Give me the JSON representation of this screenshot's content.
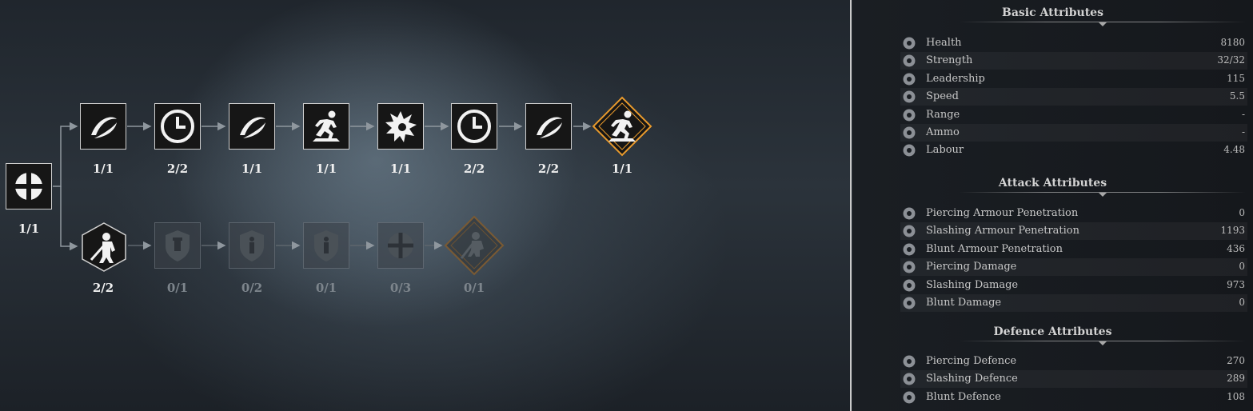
{
  "skill_tree": {
    "root": {
      "icon": "cross-emblem-icon",
      "count": "1/1"
    },
    "top_row": [
      {
        "icon": "slash-arc-icon",
        "count": "1/1",
        "state": "active"
      },
      {
        "icon": "clock-icon",
        "count": "2/2",
        "state": "active"
      },
      {
        "icon": "slash-arc-icon",
        "count": "1/1",
        "state": "active"
      },
      {
        "icon": "sprint-icon",
        "count": "1/1",
        "state": "active"
      },
      {
        "icon": "impact-burst-icon",
        "count": "1/1",
        "state": "active"
      },
      {
        "icon": "clock-icon",
        "count": "2/2",
        "state": "active"
      },
      {
        "icon": "slash-arc-icon",
        "count": "2/2",
        "state": "active"
      },
      {
        "icon": "sprint-icon",
        "count": "1/1",
        "state": "ultimate"
      }
    ],
    "bottom_row": [
      {
        "icon": "knight-sword-icon",
        "count": "2/2",
        "state": "active-hex"
      },
      {
        "icon": "shield-tower-icon",
        "count": "0/1",
        "state": "locked"
      },
      {
        "icon": "shield-figure-icon",
        "count": "0/2",
        "state": "locked"
      },
      {
        "icon": "shield-figure-icon",
        "count": "0/1",
        "state": "locked"
      },
      {
        "icon": "cross-emblem-icon",
        "count": "0/3",
        "state": "locked"
      },
      {
        "icon": "knight-sword-icon",
        "count": "0/1",
        "state": "locked-ultimate"
      }
    ],
    "accent_color": "#e89a2c"
  },
  "attributes": {
    "basic": {
      "title": "Basic Attributes",
      "rows": [
        {
          "icon": "health-cross-icon",
          "label": "Health",
          "value": "8180"
        },
        {
          "icon": "strength-fist-icon",
          "label": "Strength",
          "value": "32/32"
        },
        {
          "icon": "leadership-laurel-icon",
          "label": "Leadership",
          "value": "115"
        },
        {
          "icon": "speed-boot-icon",
          "label": "Speed",
          "value": "5.5"
        },
        {
          "icon": "range-arrows-icon",
          "label": "Range",
          "value": "-"
        },
        {
          "icon": "ammo-bolts-icon",
          "label": "Ammo",
          "value": "-"
        },
        {
          "icon": "labour-hammer-icon",
          "label": "Labour",
          "value": "4.48"
        }
      ]
    },
    "attack": {
      "title": "Attack Attributes",
      "rows": [
        {
          "icon": "piercing-pen-icon",
          "label": "Piercing Armour Penetration",
          "value": "0"
        },
        {
          "icon": "slashing-pen-icon",
          "label": "Slashing Armour Penetration",
          "value": "1193"
        },
        {
          "icon": "blunt-pen-icon",
          "label": "Blunt Armour Penetration",
          "value": "436"
        },
        {
          "icon": "piercing-damage-icon",
          "label": "Piercing Damage",
          "value": "0"
        },
        {
          "icon": "slashing-damage-icon",
          "label": "Slashing Damage",
          "value": "973"
        },
        {
          "icon": "blunt-damage-icon",
          "label": "Blunt Damage",
          "value": "0"
        }
      ]
    },
    "defence": {
      "title": "Defence Attributes",
      "rows": [
        {
          "icon": "piercing-defence-icon",
          "label": "Piercing Defence",
          "value": "270"
        },
        {
          "icon": "slashing-defence-icon",
          "label": "Slashing Defence",
          "value": "289"
        },
        {
          "icon": "blunt-defence-icon",
          "label": "Blunt Defence",
          "value": "108"
        }
      ]
    }
  }
}
